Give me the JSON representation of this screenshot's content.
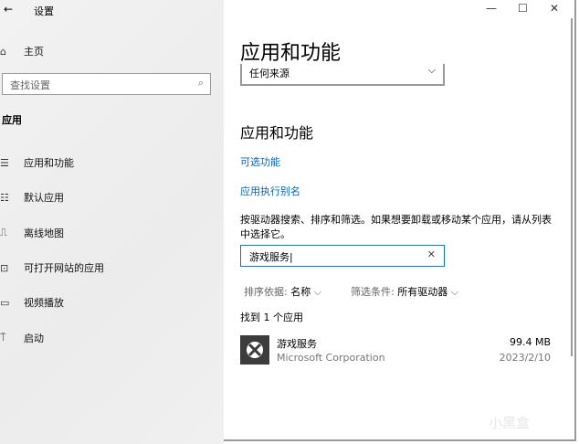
{
  "titlebar": {
    "back": "←",
    "title": "设置",
    "minimize": "—",
    "maximize": "☐",
    "close": "✕"
  },
  "sidebar": {
    "home": "主页",
    "search_placeholder": "查找设置",
    "section": "应用",
    "items": [
      {
        "label": "应用和功能",
        "icon": "apps-features-icon"
      },
      {
        "label": "默认应用",
        "icon": "default-apps-icon"
      },
      {
        "label": "离线地图",
        "icon": "offline-maps-icon"
      },
      {
        "label": "可打开网站的应用",
        "icon": "apps-for-websites-icon"
      },
      {
        "label": "视频播放",
        "icon": "video-playback-icon"
      },
      {
        "label": "启动",
        "icon": "startup-icon"
      }
    ]
  },
  "main": {
    "page_title": "应用和功能",
    "source_dropdown": "任何来源",
    "section_title": "应用和功能",
    "link_optional": "可选功能",
    "link_alias": "应用执行别名",
    "description": "按驱动器搜索、排序和筛选。如果想要卸载或移动某个应用，请从列表中选择它。",
    "search_value": "游戏服务",
    "sort_label": "排序依据:",
    "sort_value": "名称",
    "filter_label": "筛选条件:",
    "filter_value": "所有驱动器",
    "result_count": "找到 1 个应用",
    "apps": [
      {
        "name": "游戏服务",
        "publisher": "Microsoft Corporation",
        "size": "99.4 MB",
        "date": "2023/2/10"
      }
    ]
  },
  "watermark": "小黑盒"
}
